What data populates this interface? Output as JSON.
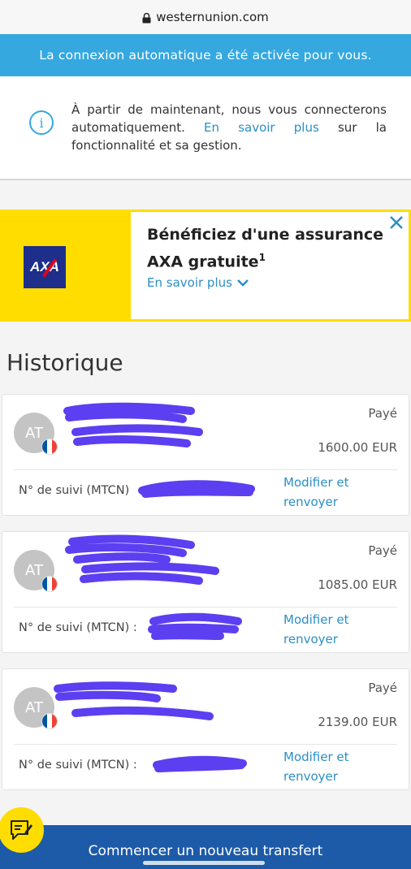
{
  "browser": {
    "url": "westernunion.com"
  },
  "banner": {
    "text": "La connexion automatique a été activée pour vous."
  },
  "info": {
    "text": "À partir de maintenant, nous vous connecterons automatiquement.",
    "link": "En savoir plus",
    "text_after": "sur la fonctionnalité et sa gestion."
  },
  "promo": {
    "logo": "AXA",
    "title_line1": "Bénéficiez d'une assurance",
    "title_line2": "AXA gratuite",
    "footnote": "1",
    "link": "En savoir plus"
  },
  "history": {
    "title": "Historique",
    "transactions": [
      {
        "initials": "AT",
        "status": "Payé",
        "amount": "1600.00 EUR",
        "tracking_label": "N° de suivi (MTCN)",
        "action": "Modifier et renvoyer"
      },
      {
        "initials": "AT",
        "status": "Payé",
        "amount": "1085.00 EUR",
        "tracking_label": "N° de suivi (MTCN) :",
        "action": "Modifier et renvoyer"
      },
      {
        "initials": "AT",
        "status": "Payé",
        "amount": "2139.00 EUR",
        "tracking_label": "N° de suivi (MTCN) :",
        "action": "Modifier et renvoyer"
      }
    ]
  },
  "cta": {
    "label": "Commencer un nouveau transfert"
  },
  "colors": {
    "banner": "#35a8e0",
    "link": "#2b8fc6",
    "promo_yellow": "#ffdd00",
    "axa_blue": "#1d2f8a",
    "cta_blue": "#1d5ba8",
    "redaction": "#5b3ff0"
  },
  "icons": [
    "lock-icon",
    "info-icon",
    "close-icon",
    "chevron-down-icon",
    "flag-fr-icon",
    "chat-icon"
  ]
}
